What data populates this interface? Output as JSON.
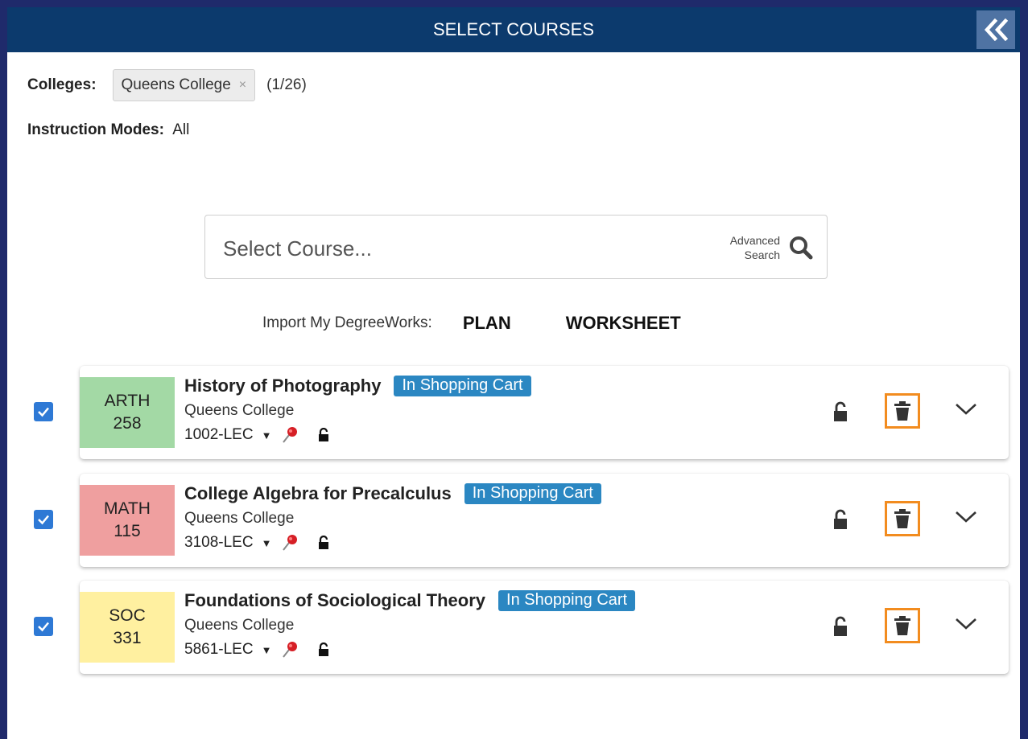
{
  "header": {
    "title": "SELECT COURSES"
  },
  "filters": {
    "colleges_label": "Colleges:",
    "college_chip": "Queens College",
    "college_chip_remove": "×",
    "college_count": "(1/26)",
    "modes_label": "Instruction Modes:",
    "modes_value": "All"
  },
  "search": {
    "placeholder": "Select Course...",
    "advanced_line1": "Advanced",
    "advanced_line2": "Search"
  },
  "import": {
    "label": "Import My DegreeWorks:",
    "plan": "PLAN",
    "worksheet": "WORKSHEET"
  },
  "courses": [
    {
      "subject": "ARTH",
      "number": "258",
      "title": "History of Photography",
      "badge": "In Shopping Cart",
      "college": "Queens College",
      "section": "1002-LEC",
      "checked": true,
      "color": "#a3d9a5"
    },
    {
      "subject": "MATH",
      "number": "115",
      "title": "College Algebra for Precalculus",
      "badge": "In Shopping Cart",
      "college": "Queens College",
      "section": "3108-LEC",
      "checked": true,
      "color": "#ef9f9f"
    },
    {
      "subject": "SOC",
      "number": "331",
      "title": "Foundations of Sociological Theory",
      "badge": "In Shopping Cart",
      "college": "Queens College",
      "section": "5861-LEC",
      "checked": true,
      "color": "#fff0a0"
    }
  ],
  "colors": {
    "header_bg": "#0c3a6d",
    "badge_bg": "#2b87c2",
    "checkbox": "#2e79d5",
    "trash_highlight": "#f28c1f",
    "border": "#1f2a6b"
  }
}
